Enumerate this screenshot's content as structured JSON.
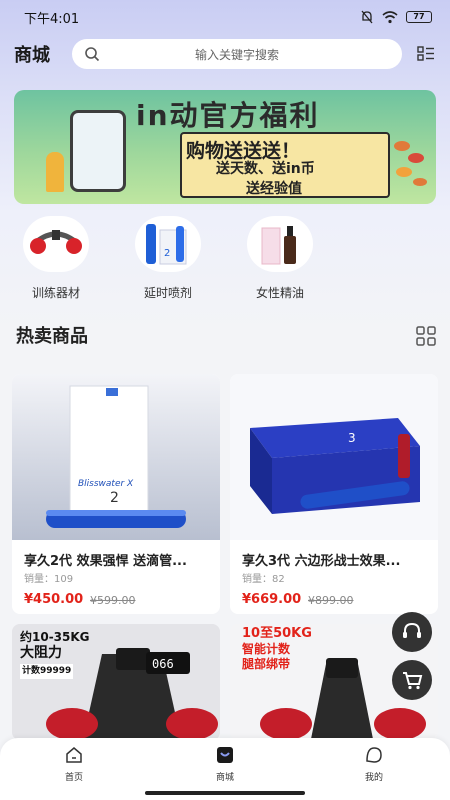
{
  "status_bar": {
    "time": "下午4:01",
    "battery": "77"
  },
  "header": {
    "title": "商城",
    "search_placeholder": "输入关键字搜索"
  },
  "banner": {
    "title": "in动官方福利",
    "line1": "购物送送送！",
    "line2": "送天数、送in币",
    "line3": "送经验值"
  },
  "categories": [
    {
      "label": "训练器材",
      "icon": "trainer-icon"
    },
    {
      "label": "延时喷剂",
      "icon": "spray-icon"
    },
    {
      "label": "女性精油",
      "icon": "oil-bottle-icon"
    }
  ],
  "section": {
    "title": "热卖商品"
  },
  "products": [
    {
      "name": "享久2代 效果强悍 送滴管...",
      "sales": "销量：109",
      "price": "¥450.00",
      "original_price": "¥599.00",
      "box_text": "2"
    },
    {
      "name": "享久3代 六边形战士效果...",
      "sales": "销量：82",
      "price": "¥669.00",
      "original_price": "¥899.00",
      "box_text": "3"
    },
    {
      "promo_lines": [
        "约10-35KG",
        "大阻力",
        "计数99999"
      ],
      "display": "066"
    },
    {
      "promo_lines": [
        "10至50KG",
        "智能计数",
        "腿部绑带"
      ]
    }
  ],
  "bottom_nav": [
    {
      "label": "首页",
      "icon": "home-icon"
    },
    {
      "label": "商城",
      "icon": "shop-icon"
    },
    {
      "label": "我的",
      "icon": "profile-icon"
    }
  ],
  "colors": {
    "price": "#e2231a",
    "header_gradient_top": "#c9cdf3",
    "banner_green": "#9ed79c"
  }
}
